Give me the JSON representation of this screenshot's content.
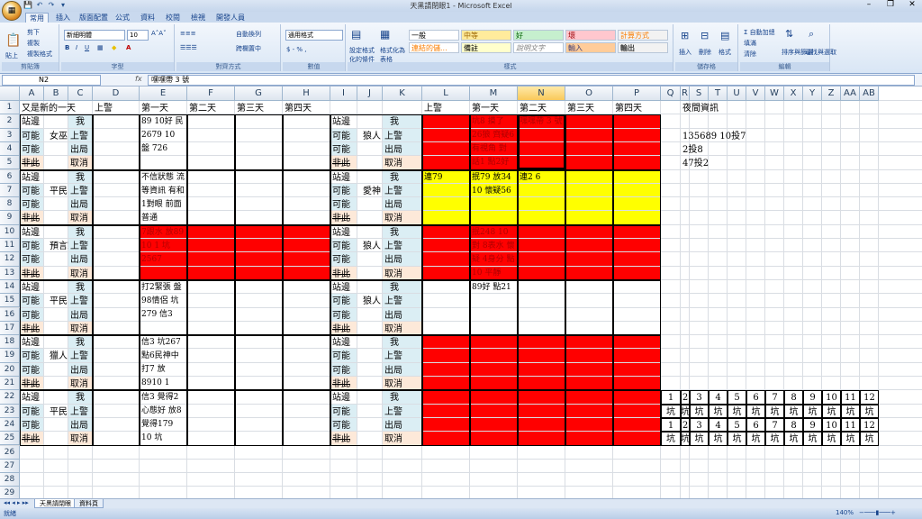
{
  "window": {
    "title": "天黑請閉眼1 - Microsoft Excel",
    "qat": [
      "💾",
      "↶",
      "↷",
      "▾"
    ],
    "controls": [
      "–",
      "❐",
      "✕"
    ]
  },
  "ribbon": {
    "tabs": [
      "常用",
      "插入",
      "版面配置",
      "公式",
      "資料",
      "校閱",
      "檢視",
      "開發人員"
    ],
    "clipboard": {
      "paste": "貼上",
      "cut": "剪下",
      "copy": "複製",
      "format_painter": "複製格式",
      "label": "剪貼簿"
    },
    "font": {
      "name": "新細明體",
      "size": "10",
      "label": "字型",
      "bold": "B",
      "italic": "I",
      "underline": "U"
    },
    "alignment": {
      "wrap": "自動換列",
      "merge": "跨欄置中",
      "label": "對齊方式"
    },
    "number": {
      "format": "通用格式",
      "label": "數值",
      "symbols": "$ - % ,"
    },
    "styles": {
      "conditional": "設定格式化的條件",
      "table": "格式化為表格",
      "cells": [
        {
          "text": "一般",
          "bg": "#ffffff",
          "color": "#000000"
        },
        {
          "text": "中等",
          "bg": "#ffeb9c",
          "color": "#9c6500"
        },
        {
          "text": "好",
          "bg": "#c6efce",
          "color": "#006100"
        },
        {
          "text": "壞",
          "bg": "#ffc7ce",
          "color": "#9c0006"
        },
        {
          "text": "計算方式",
          "bg": "#f2f2f2",
          "color": "#fa7d00"
        },
        {
          "text": "連結的儲...",
          "bg": "#ffffff",
          "color": "#fa7d00"
        },
        {
          "text": "備註",
          "bg": "#ffffcc",
          "color": "#000000"
        },
        {
          "text": "說明文字",
          "bg": "#ffffff",
          "color": "#7f7f7f"
        },
        {
          "text": "輸入",
          "bg": "#ffcc99",
          "color": "#3f3f76"
        },
        {
          "text": "輸出",
          "bg": "#f2f2f2",
          "color": "#3f3f3f"
        }
      ],
      "label": "樣式"
    },
    "cells_group": {
      "insert": "插入",
      "delete": "刪除",
      "format": "格式",
      "label": "儲存格"
    },
    "editing": {
      "autosum": "自動加總",
      "fill": "填滿",
      "clear": "清除",
      "sort": "排序與篩選",
      "find": "尋找與選取",
      "label": "編輯"
    }
  },
  "formula_bar": {
    "name_box": "N2",
    "fx": "fx",
    "value": "嘿嘿帶 3 號"
  },
  "columns": [
    "A",
    "B",
    "C",
    "D",
    "E",
    "F",
    "G",
    "H",
    "I",
    "J",
    "K",
    "L",
    "M",
    "N",
    "O",
    "P",
    "Q",
    "R",
    "S",
    "T",
    "U",
    "V",
    "W",
    "X",
    "Y",
    "Z",
    "AA",
    "AB"
  ],
  "selected_column": "N",
  "rows": [
    "1",
    "2",
    "3",
    "4",
    "5",
    "6",
    "7",
    "8",
    "9",
    "10",
    "11",
    "12",
    "13",
    "14",
    "15",
    "16",
    "17",
    "18",
    "19",
    "20",
    "21",
    "22",
    "23",
    "24",
    "25",
    "26",
    "27",
    "28",
    "29"
  ],
  "headers": {
    "a1": "又是新的一天",
    "d1": "上警",
    "e1": "第一天",
    "f1": "第二天",
    "g1": "第三天",
    "h1": "第四天",
    "l1": "上警",
    "m1": "第一天",
    "n1": "第二天",
    "o1": "第三天",
    "p1": "第四天",
    "r1": "夜間資訊"
  },
  "labels": {
    "stand": "站邊",
    "possible": "可能",
    "not": "非此",
    "me": "我",
    "police": "上警",
    "out": "出局",
    "cancel": "取消"
  },
  "left_roles": [
    "女巫",
    "平民",
    "預言家",
    "平民",
    "獵人",
    "平民"
  ],
  "right_roles": [
    "狼人",
    "愛神",
    "狼人",
    "狼人",
    "",
    ""
  ],
  "left_notes": [
    "89 10好 民 2679 10 盤 726",
    "不信狀態 流 等資訊 有和1對眼 前面普通",
    "7跟水 放89 10 1 坑2567",
    "打2緊張 盤 98情侶 坑 279 信3",
    "信3 坑267 點6民神中 打7 放8910 1",
    "信3 覺得2 心態好 放8 覺得179 10 坑"
  ],
  "right_notes": {
    "l6": "連79",
    "m2": "坑8 摸了 26狼 齊疑6 有視角 對 話1 點2好",
    "n2": "嘿嘿帶 3 號",
    "m6": "抿79 放34 10 懷疑56",
    "n6": "連2 6",
    "m10": "抿248 10 對 8表水 懷疑 4身分 點10 平靜",
    "m14": "89好 點21"
  },
  "night_info": [
    "135689 10投7",
    "2投8",
    "47投2"
  ],
  "numbers": [
    "1",
    "2",
    "3",
    "4",
    "5",
    "6",
    "7",
    "8",
    "9",
    "10",
    "11",
    "12"
  ],
  "keng": "坑",
  "sheets": [
    "天黑請閉眼",
    "資料頁"
  ],
  "status": {
    "ready": "就緒",
    "zoom": "140%"
  },
  "colors": {
    "red": "#ff0000",
    "yellow": "#ffff00",
    "blue_cell": "#dbeef4",
    "peach_cell": "#fde9d9",
    "selection": "#f9c95a"
  }
}
